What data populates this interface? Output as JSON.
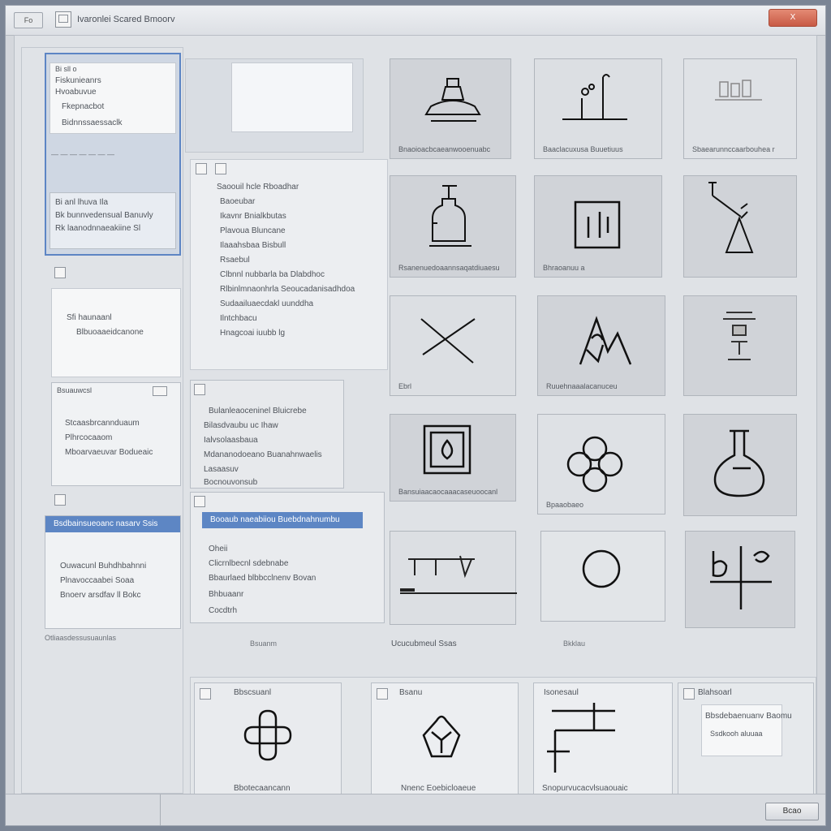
{
  "window": {
    "title": "Ivaronlei Scared Bmoorv",
    "menu_button": "Fo",
    "close_label": "X"
  },
  "left": {
    "panel1": {
      "lines": [
        "Bi sll o",
        "Fiskunieanrs",
        "Hvoabuvue",
        "Fkepnacbot",
        "Bidnnssaessaclk"
      ]
    },
    "panel1b": {
      "lines": [
        "Bi anl lhuva Ila",
        "Bk bunnvedensual Banuvly",
        "Rk laanodnnaeakiine Sl"
      ]
    },
    "panel2": {
      "lines": [
        "Sfi haunaanl",
        "Blbuoaaeidcanone"
      ]
    },
    "panel3": {
      "header": "Bsuauwcsl",
      "lines": [
        "Stcaasbrcannduaum",
        "Plhrcocaaom",
        "Mboarvaeuvar Bodueaic"
      ]
    },
    "panel4": {
      "header": "Bsdbainsueoanc nasarv Ssis",
      "lines": [
        "Ouwacunl Buhdhbahnni",
        "Plnavoccaabei Soaa",
        "Bnoerv arsdfav ll Bokc"
      ],
      "footer": "Otliaasdessusuaunlas"
    }
  },
  "mid": {
    "list1": [
      "Saoouil hcle Rboadhar",
      "Baoeubar",
      "Ikavnr Bnialkbutas",
      "Plavoua Bluncane",
      "Ilaaahsbaa Bisbull",
      "Rsaebul",
      "Clbnnl nubbarla ba Dlabdhoc",
      "Rlbinlmnaonhrla Seoucadanisadhdoa",
      "Sudaailuaecdakl uunddha",
      "Ilntchbacu",
      "Hnagcoai iuubb lg"
    ],
    "list2": [
      "Bulanleaoceninel Bluicrebe",
      "Bilasdvaubu uc Ihaw",
      "Ialvsolaasbaua",
      "Mdananodoeano Buanahnwaelis",
      "Lasaasuv",
      "Bocnouvonsub"
    ],
    "bar_header": "Booaub naeabiiou Buebdnahnumbu",
    "list3": [
      "Oheii",
      "Clicrnlbecnl sdebnabe",
      "Bbaurlaed blbbcclnenv Bovan",
      "Bhbuaanr",
      "Cocdtrh"
    ],
    "status1": "Bsuanm",
    "status2": "Ucucubmeul Ssas",
    "status3": "Bkklau"
  },
  "tiles": [
    {
      "icon": "flask-lamp-icon",
      "caption": "Bnaoioacbcaeanwooenuabc"
    },
    {
      "icon": "tripod-icon",
      "caption": "Baaclacuxusa Buuetiuus"
    },
    {
      "icon": "bar-chart-icon",
      "caption": "Sbaearunnccaarbouhea r"
    },
    {
      "icon": "bottle-icon",
      "caption": "Rsanenuedoaannsaqatdiuaesu"
    },
    {
      "icon": "box-vessel-icon",
      "caption": "Bhraoanuu a"
    },
    {
      "icon": "retort-stand-icon",
      "caption": ""
    },
    {
      "icon": "cross-icon",
      "caption": "Ebrl"
    },
    {
      "icon": "tent-shapes-icon",
      "caption": "Ruuehnaaalacanuceu"
    },
    {
      "icon": "stacked-lamp-icon",
      "caption": ""
    },
    {
      "icon": "framed-droplet-icon",
      "caption": "Bansuiaacaocaaacaseuoocanl"
    },
    {
      "icon": "clover-icon",
      "caption": "Bpaaobaeo"
    },
    {
      "icon": "round-flask-icon",
      "caption": ""
    },
    {
      "icon": "balance-line-icon",
      "caption": ""
    },
    {
      "icon": "circle-icon",
      "caption": ""
    },
    {
      "icon": "glyph-cross-icon",
      "caption": ""
    }
  ],
  "bottom": {
    "c1_title": "Bbscsuanl",
    "c1_caption": "Bbotecaancann",
    "c2_title": "Bsanu",
    "c2_caption": "Nnenc Eoebicloaeue",
    "c3_title": "Isonesaul",
    "c3_caption": "Snopurvucacvlsuaouaic",
    "c4_title": "Blahsoarl",
    "c4_lines": [
      "Bbsdebaenuanv Baomu",
      "Ssdkooh aluuaa"
    ]
  },
  "footer": {
    "ok_label": "Bcao"
  }
}
